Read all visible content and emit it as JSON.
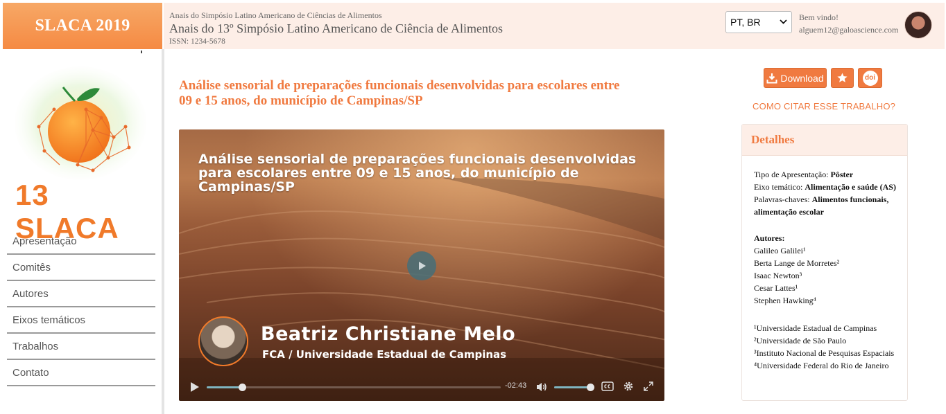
{
  "brand": {
    "label": "SLACA 2019"
  },
  "header": {
    "series": "Anais do Simpósio Latino Americano de Ciências de Alimentos",
    "title": "Anais do 13º Simpósio Latino Americano de Ciência de Alimentos",
    "issn": "ISSN: 1234-5678",
    "language": "PT, BR",
    "welcome": "Bem vindo!",
    "email": "alguem12@galoascience.com"
  },
  "logo": {
    "text": "13 SLACA"
  },
  "nav": {
    "items": [
      "Apresentação",
      "Comitês",
      "Autores",
      "Eixos temáticos",
      "Trabalhos",
      "Contato"
    ]
  },
  "article": {
    "title_line1": "Análise sensorial de preparações funcionais desenvolvidas para escolares entre",
    "title_line2": "09 e 15 anos, do município de Campinas/SP"
  },
  "video": {
    "overlay_title_line1": "Análise sensorial de preparações funcionais desenvolvidas",
    "overlay_title_line2": "para escolares entre 09 e 15 anos, do município de",
    "overlay_title_line3": "Campinas/SP",
    "presenter_name": "Beatriz Christiane Melo",
    "presenter_institution": "FCA / Universidade Estadual de Campinas",
    "time_remaining": "-02:43",
    "progress_fraction": 0.12,
    "volume_fraction": 1.0
  },
  "actions": {
    "download_label": "Download",
    "doi_label": "doi",
    "cite_label": "COMO CITAR ESSE TRABALHO?"
  },
  "details": {
    "heading": "Detalhes",
    "presentation_type_label": "Tipo de Apresentação: ",
    "presentation_type_value": "Pôster",
    "theme_label": "Eixo temático: ",
    "theme_value": "Alimentação e saúde (AS)",
    "keywords_label": "Palavras-chaves: ",
    "keywords_value_1": "Alimentos funcionais,",
    "keywords_value_2": "alimentação escolar",
    "authors_heading": "Autores:",
    "authors": [
      "Galileo Galilei¹",
      "Berta Lange de Morretes²",
      "Isaac Newton³",
      "Cesar Lattes¹",
      "Stephen Hawking⁴"
    ],
    "affiliations": [
      "¹Universidade Estadual de Campinas",
      "²Universidade de São Paulo",
      "³Instituto Nacional de Pesquisas Espaciais",
      "⁴Universidade Federal do Rio de Janeiro"
    ]
  },
  "colors": {
    "accent": "#f07a40",
    "header_bg": "#fdeee7",
    "brand_bg": "#f58a43"
  }
}
